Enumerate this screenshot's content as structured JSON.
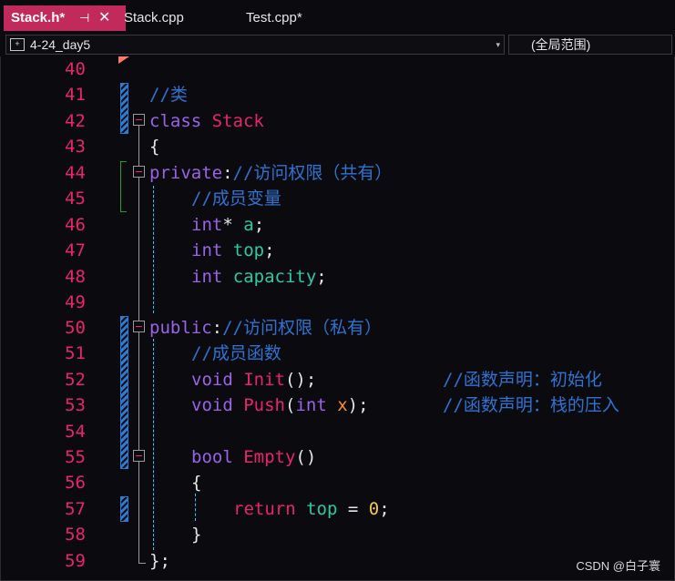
{
  "tabs": [
    {
      "label": "Stack.h*",
      "pin_glyph": "⊣",
      "close_glyph": "✕"
    },
    {
      "label": "Stack.cpp"
    },
    {
      "label": "Test.cpp*"
    }
  ],
  "nav": {
    "scope_icon_glyph": "+",
    "scope_label": "4-24_day5",
    "member_label": "(全局范围)",
    "arrow_glyph": "▾"
  },
  "editor": {
    "line_numbers": [
      "40",
      "41",
      "42",
      "43",
      "44",
      "45",
      "46",
      "47",
      "48",
      "49",
      "50",
      "51",
      "52",
      "53",
      "54",
      "55",
      "56",
      "57",
      "58",
      "59"
    ],
    "code": {
      "l41_cm": "//类",
      "l42_kw": "class",
      "l42_cls": "Stack",
      "l43_text": "{",
      "l44_kw": "private",
      "l44_colon": ":",
      "l44_cm": "//访问权限（共有）",
      "l45_cm": "//成员变量",
      "l46_type": "int",
      "l46_star": "*",
      "l46_var": "a",
      "l46_semi": ";",
      "l47_type": "int",
      "l47_var": "top",
      "l47_semi": ";",
      "l48_type": "int",
      "l48_var": "capacity",
      "l48_semi": ";",
      "l50_kw": "public",
      "l50_colon": ":",
      "l50_cm": "//访问权限（私有）",
      "l51_cm": "//成员函数",
      "l52_type": "void",
      "l52_fn": "Init",
      "l52_punc": "();",
      "l52_cm": "//函数声明：初始化",
      "l53_type": "void",
      "l53_fn": "Push",
      "l53_open": "(",
      "l53_ptype": "int",
      "l53_param": "x",
      "l53_close": ");",
      "l53_cm": "//函数声明：栈的压入",
      "l55_type": "bool",
      "l55_fn": "Empty",
      "l55_punc": "()",
      "l56_text": "{",
      "l57_kw": "return",
      "l57_var": "top",
      "l57_op": " = ",
      "l57_num": "0",
      "l57_semi": ";",
      "l58_text": "}",
      "l59_text": "};"
    }
  },
  "watermark": "CSDN @白子寰",
  "colors": {
    "accent_tab": "#c12a5a",
    "line_number": "#e8256a",
    "keyword": "#9a63e8",
    "comment": "#2f72d0",
    "identifier": "#2dc9a6",
    "function": "#e8256a",
    "parameter": "#ff8c32",
    "number": "#f2c94c"
  }
}
